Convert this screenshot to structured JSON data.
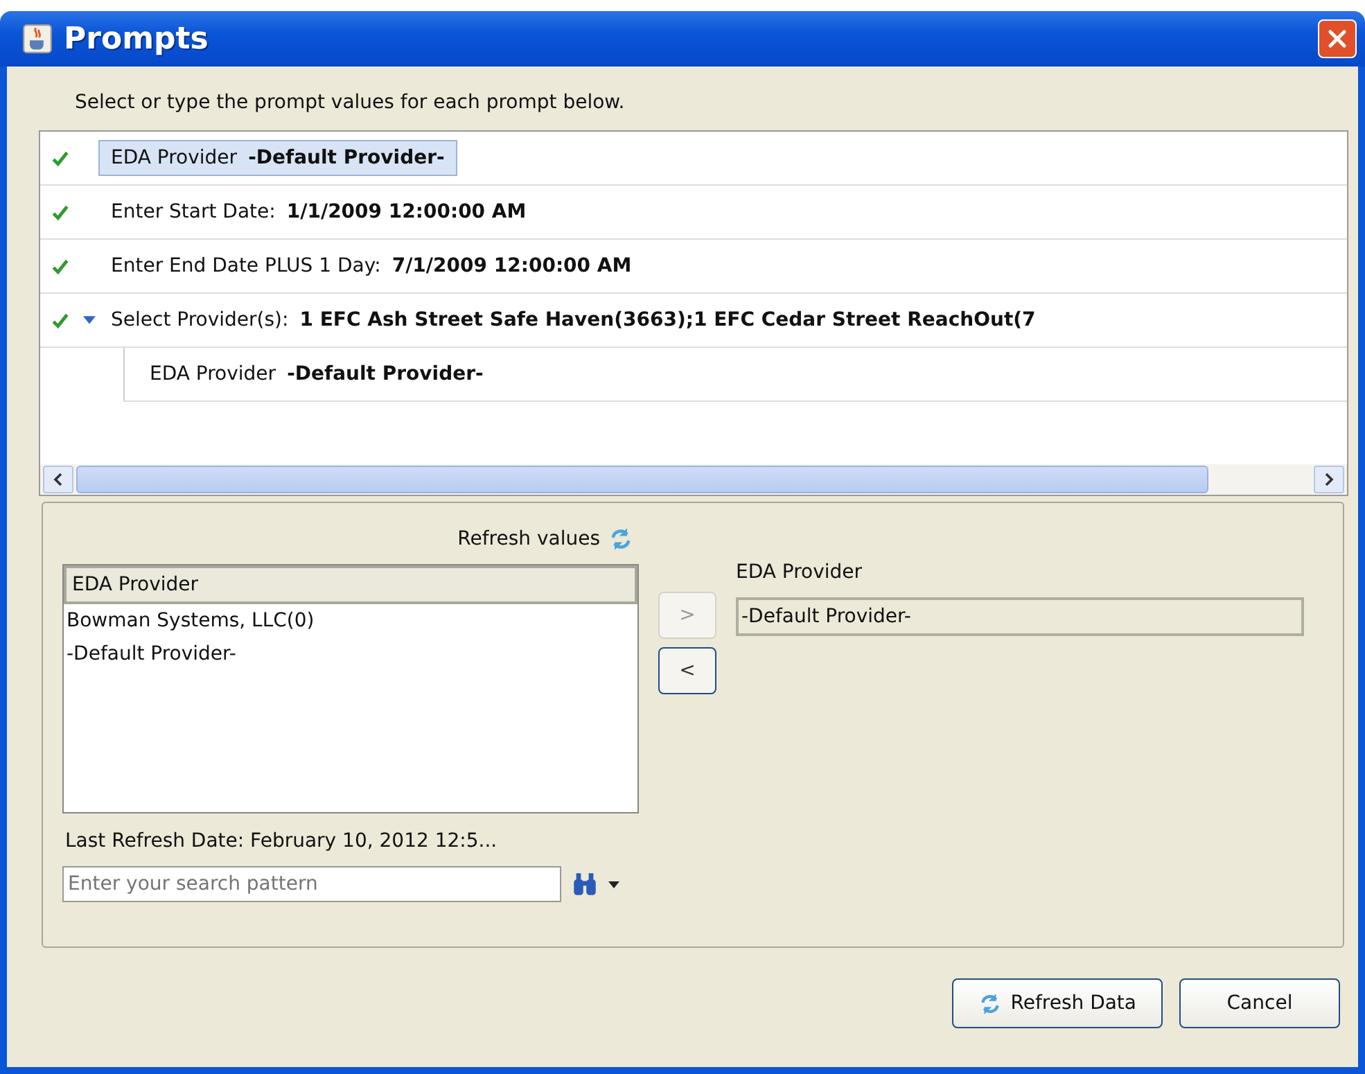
{
  "window": {
    "title": "Prompts"
  },
  "instruction": "Select or type the prompt values for each prompt below.",
  "prompts": [
    {
      "label": "EDA Provider",
      "value": "-Default Provider-",
      "checked": true,
      "selected": true,
      "expanded": false
    },
    {
      "label": "Enter Start Date:",
      "value": "1/1/2009 12:00:00 AM",
      "checked": true,
      "selected": false,
      "expanded": false
    },
    {
      "label": "Enter End Date PLUS 1 Day:",
      "value": "7/1/2009 12:00:00 AM",
      "checked": true,
      "selected": false,
      "expanded": false
    },
    {
      "label": "Select Provider(s):",
      "value": "1 EFC Ash Street Safe Haven(3663);1 EFC Cedar Street ReachOut(7",
      "checked": true,
      "selected": false,
      "expanded": true,
      "children": [
        {
          "label": "EDA Provider",
          "value": "-Default Provider-",
          "checked": false,
          "selected": false
        }
      ]
    }
  ],
  "values_panel": {
    "refresh_label": "Refresh values",
    "list_header": "EDA Provider",
    "items": [
      "Bowman Systems, LLC(0)",
      "-Default Provider-"
    ],
    "last_refresh": "Last Refresh Date: February 10, 2012 12:5...",
    "search": {
      "placeholder": "Enter your search pattern"
    }
  },
  "move_buttons": [
    {
      "label": ">",
      "disabled": true
    },
    {
      "label": "<",
      "disabled": false
    }
  ],
  "selected_panel": {
    "label": "EDA Provider",
    "value": "-Default Provider-"
  },
  "buttons": [
    {
      "label": "Refresh Data",
      "kind": "refresh"
    },
    {
      "label": "Cancel",
      "kind": "plain"
    }
  ]
}
